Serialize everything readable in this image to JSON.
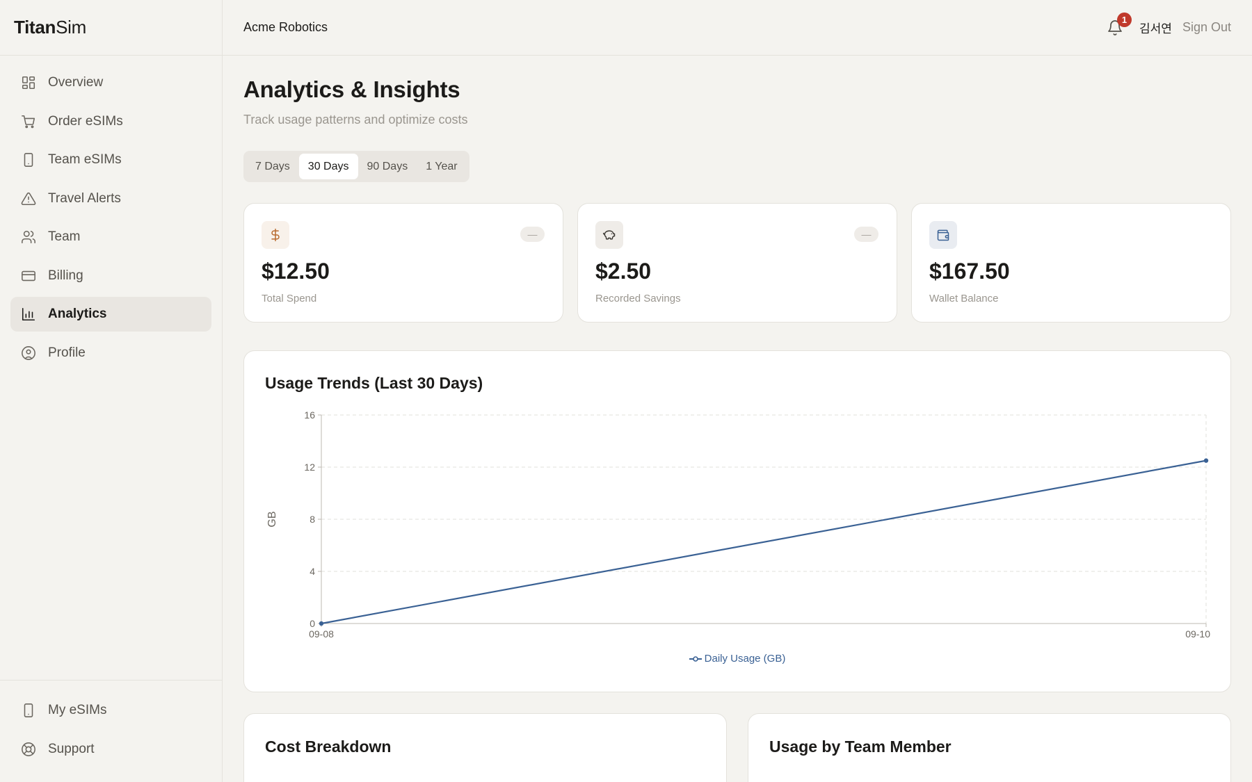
{
  "brand": {
    "bold": "Titan",
    "light": "Sim"
  },
  "sidebar": {
    "items": [
      {
        "label": "Overview",
        "icon": "grid-icon",
        "active": false
      },
      {
        "label": "Order eSIMs",
        "icon": "cart-icon",
        "active": false
      },
      {
        "label": "Team eSIMs",
        "icon": "phone-icon",
        "active": false
      },
      {
        "label": "Travel Alerts",
        "icon": "alert-triangle-icon",
        "active": false
      },
      {
        "label": "Team",
        "icon": "users-icon",
        "active": false
      },
      {
        "label": "Billing",
        "icon": "credit-card-icon",
        "active": false
      },
      {
        "label": "Analytics",
        "icon": "bar-chart-icon",
        "active": true
      },
      {
        "label": "Profile",
        "icon": "user-circle-icon",
        "active": false
      }
    ],
    "bottom_items": [
      {
        "label": "My eSIMs",
        "icon": "phone-icon"
      },
      {
        "label": "Support",
        "icon": "lifebuoy-icon"
      }
    ]
  },
  "header": {
    "org": "Acme Robotics",
    "notification_count": "1",
    "user": "김서연",
    "sign_out": "Sign Out"
  },
  "page": {
    "title": "Analytics & Insights",
    "subtitle": "Track usage patterns and optimize costs"
  },
  "tabs": [
    {
      "label": "7 Days",
      "active": false
    },
    {
      "label": "30 Days",
      "active": true
    },
    {
      "label": "90 Days",
      "active": false
    },
    {
      "label": "1 Year",
      "active": false
    }
  ],
  "cards": [
    {
      "value": "$12.50",
      "label": "Total Spend",
      "icon": "dollar-icon",
      "trend": "—",
      "icon_color": "#b86a2e",
      "icon_bg": "#f8f1ea"
    },
    {
      "value": "$2.50",
      "label": "Recorded Savings",
      "icon": "piggy-bank-icon",
      "trend": "—",
      "icon_color": "#3d3a35",
      "icon_bg": "#efece8"
    },
    {
      "value": "$167.50",
      "label": "Wallet Balance",
      "icon": "wallet-icon",
      "trend": "",
      "icon_color": "#3a6194",
      "icon_bg": "#e9ecf1"
    }
  ],
  "usage_panel": {
    "title": "Usage Trends (Last 30 Days)"
  },
  "chart_data": {
    "type": "line",
    "title": "Usage Trends (Last 30 Days)",
    "x": [
      "09-08",
      "09-10"
    ],
    "series": [
      {
        "name": "Daily Usage (GB)",
        "values": [
          0,
          12.5
        ]
      }
    ],
    "xlabel": "",
    "ylabel": "GB",
    "ylim": [
      0,
      16
    ],
    "yticks": [
      0,
      4,
      8,
      12,
      16
    ],
    "grid": true,
    "legend": "bottom",
    "color": "#3a6194"
  },
  "bottom_panels": [
    {
      "title": "Cost Breakdown"
    },
    {
      "title": "Usage by Team Member"
    }
  ]
}
